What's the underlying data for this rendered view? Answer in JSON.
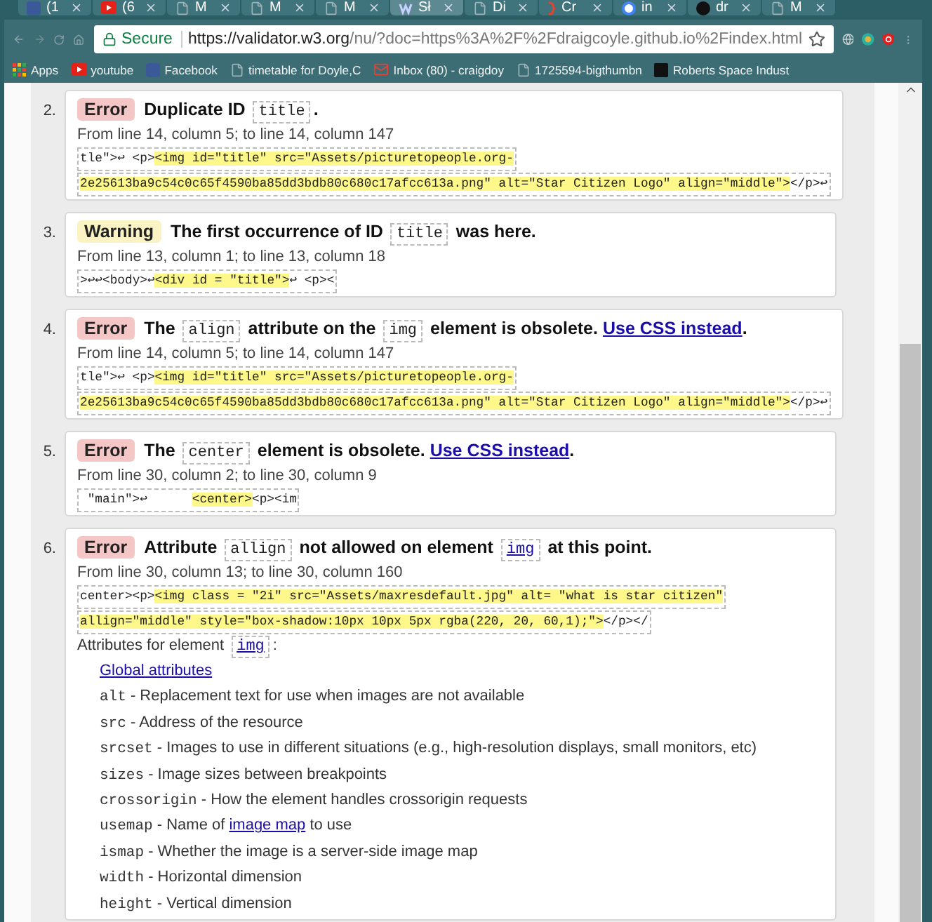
{
  "browser": {
    "tabs": [
      {
        "kind": "facebook",
        "label": "(1",
        "selected": false
      },
      {
        "kind": "youtube",
        "label": "(6",
        "selected": false
      },
      {
        "kind": "page",
        "label": "M",
        "selected": false
      },
      {
        "kind": "page",
        "label": "M",
        "selected": false
      },
      {
        "kind": "page",
        "label": "M",
        "selected": false
      },
      {
        "kind": "validator",
        "label": "Sł",
        "selected": true
      },
      {
        "kind": "page",
        "label": "Di",
        "selected": false
      },
      {
        "kind": "bracket",
        "label": "Cr",
        "selected": false
      },
      {
        "kind": "google",
        "label": "in",
        "selected": false
      },
      {
        "kind": "github",
        "label": "dr",
        "selected": false
      },
      {
        "kind": "page",
        "label": "M",
        "selected": false
      }
    ],
    "address": {
      "secure_label": "Secure",
      "url_host": "https://validator.w3.org",
      "url_rest": "/nu/?doc=https%3A%2F%2Fdraigcoyle.github.io%2Findex.html"
    },
    "bookmarks": [
      {
        "kind": "apps",
        "label": "Apps"
      },
      {
        "kind": "youtube",
        "label": "youtube"
      },
      {
        "kind": "facebook",
        "label": "Facebook"
      },
      {
        "kind": "page",
        "label": "timetable for Doyle,C"
      },
      {
        "kind": "mail",
        "label": "Inbox (80) - craigdoy"
      },
      {
        "kind": "page",
        "label": "1725594-bigthumbn"
      },
      {
        "kind": "dark",
        "label": "Roberts Space Indust"
      }
    ]
  },
  "messages": [
    {
      "number": "2.",
      "kind": "error",
      "badge": "Error",
      "title": [
        {
          "kind": "text",
          "text": "Duplicate ID "
        },
        {
          "kind": "code",
          "text": "title"
        },
        {
          "kind": "text",
          "text": "."
        }
      ],
      "location": "From line 14, column 5; to line 14, column 147",
      "extract": [
        [
          {
            "text": "tle\">↩ <p>",
            "highlight": false
          },
          {
            "text": "<img id=\"title\" src=\"Assets/picturetopeople.org-",
            "highlight": true
          }
        ],
        [
          {
            "text": "2e25613ba9c54c0c65f4590ba85dd3bdb80c680c17afcc613a.png\" alt=\"Star Citizen Logo\" align=\"middle\">",
            "highlight": true
          },
          {
            "text": "</p>↩",
            "highlight": false
          }
        ]
      ]
    },
    {
      "number": "3.",
      "kind": "warning",
      "badge": "Warning",
      "title": [
        {
          "kind": "text",
          "text": "The first occurrence of ID "
        },
        {
          "kind": "code",
          "text": "title"
        },
        {
          "kind": "text",
          "text": " was here."
        }
      ],
      "location": "From line 13, column 1; to line 13, column 18",
      "extract": [
        [
          {
            "text": ">↩↩<body>↩",
            "highlight": false
          },
          {
            "text": "<div id = \"title\">",
            "highlight": true
          },
          {
            "text": "↩ <p><",
            "highlight": false
          }
        ]
      ]
    },
    {
      "number": "4.",
      "kind": "error",
      "badge": "Error",
      "title": [
        {
          "kind": "text",
          "text": "The "
        },
        {
          "kind": "code",
          "text": "align"
        },
        {
          "kind": "text",
          "text": " attribute on the "
        },
        {
          "kind": "code",
          "text": "img"
        },
        {
          "kind": "text",
          "text": " element is obsolete. "
        },
        {
          "kind": "link",
          "text": "Use CSS instead"
        },
        {
          "kind": "text",
          "text": "."
        }
      ],
      "location": "From line 14, column 5; to line 14, column 147",
      "extract": [
        [
          {
            "text": "tle\">↩ <p>",
            "highlight": false
          },
          {
            "text": "<img id=\"title\" src=\"Assets/picturetopeople.org-",
            "highlight": true
          }
        ],
        [
          {
            "text": "2e25613ba9c54c0c65f4590ba85dd3bdb80c680c17afcc613a.png\" alt=\"Star Citizen Logo\" align=\"middle\">",
            "highlight": true
          },
          {
            "text": "</p>↩",
            "highlight": false
          }
        ]
      ]
    },
    {
      "number": "5.",
      "kind": "error",
      "badge": "Error",
      "title": [
        {
          "kind": "text",
          "text": "The "
        },
        {
          "kind": "code",
          "text": "center"
        },
        {
          "kind": "text",
          "text": " element is obsolete. "
        },
        {
          "kind": "link",
          "text": "Use CSS instead"
        },
        {
          "kind": "text",
          "text": "."
        }
      ],
      "location": "From line 30, column 2; to line 30, column 9",
      "extract": [
        [
          {
            "text": " \"main\">↩      ",
            "highlight": false
          },
          {
            "text": "<center>",
            "highlight": true
          },
          {
            "text": "<p><im",
            "highlight": false
          }
        ]
      ]
    },
    {
      "number": "6.",
      "kind": "error",
      "badge": "Error",
      "title": [
        {
          "kind": "text",
          "text": "Attribute "
        },
        {
          "kind": "code",
          "text": "allign"
        },
        {
          "kind": "text",
          "text": " not allowed on element "
        },
        {
          "kind": "code_link",
          "text": "img"
        },
        {
          "kind": "text",
          "text": " at this point."
        }
      ],
      "location": "From line 30, column 13; to line 30, column 160",
      "extract": [
        [
          {
            "text": "center><p>",
            "highlight": false
          },
          {
            "text": "<img class = \"2i\" src=\"Assets/maxresdefault.jpg\" alt= \"what is star citizen\"",
            "highlight": true
          }
        ],
        [
          {
            "text": "allign=\"middle\" style=\"box-shadow:10px 10px 5px rgba(220, 20, 60,1);\">",
            "highlight": true
          },
          {
            "text": "</p></",
            "highlight": false
          }
        ]
      ],
      "attributes": {
        "heading": [
          {
            "kind": "text",
            "text": "Attributes for element "
          },
          {
            "kind": "code_link",
            "text": "img"
          },
          {
            "kind": "text",
            "text": ":"
          }
        ],
        "items": [
          {
            "kind": "link",
            "text": "Global attributes"
          },
          {
            "kind": "attr",
            "name": "alt",
            "parts": [
              {
                "kind": "text",
                "text": " - Replacement text for use when images are not available"
              }
            ]
          },
          {
            "kind": "attr",
            "name": "src",
            "parts": [
              {
                "kind": "text",
                "text": " - Address of the resource"
              }
            ]
          },
          {
            "kind": "attr",
            "name": "srcset",
            "parts": [
              {
                "kind": "text",
                "text": " - Images to use in different situations (e.g., high-resolution displays, small monitors, etc)"
              }
            ]
          },
          {
            "kind": "attr",
            "name": "sizes",
            "parts": [
              {
                "kind": "text",
                "text": " - Image sizes between breakpoints"
              }
            ]
          },
          {
            "kind": "attr",
            "name": "crossorigin",
            "parts": [
              {
                "kind": "text",
                "text": " - How the element handles crossorigin requests"
              }
            ]
          },
          {
            "kind": "attr",
            "name": "usemap",
            "parts": [
              {
                "kind": "text",
                "text": " - Name of "
              },
              {
                "kind": "link",
                "text": "image map"
              },
              {
                "kind": "text",
                "text": " to use"
              }
            ]
          },
          {
            "kind": "attr",
            "name": "ismap",
            "parts": [
              {
                "kind": "text",
                "text": " - Whether the image is a server-side image map"
              }
            ]
          },
          {
            "kind": "attr",
            "name": "width",
            "parts": [
              {
                "kind": "text",
                "text": " - Horizontal dimension"
              }
            ]
          },
          {
            "kind": "attr",
            "name": "height",
            "parts": [
              {
                "kind": "text",
                "text": " - Vertical dimension"
              }
            ]
          }
        ]
      }
    }
  ]
}
